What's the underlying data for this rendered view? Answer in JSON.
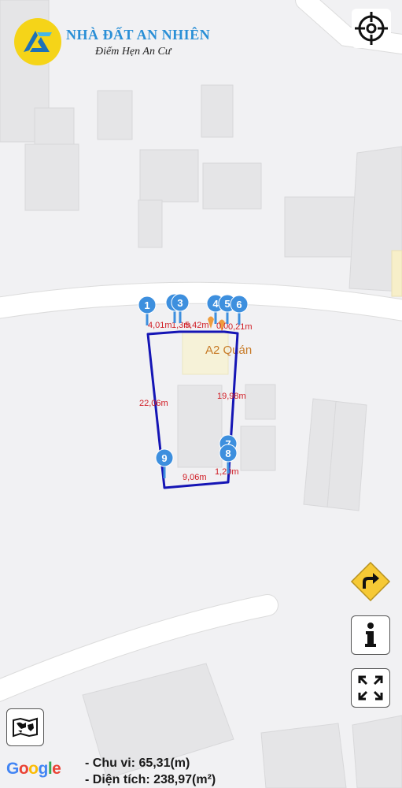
{
  "brand": {
    "name": "NHÀ ĐẤT AN NHIÊN",
    "slogan": "Điểm Hẹn An Cư",
    "accent": "#2a8fd6",
    "logo_color": "#f5d418"
  },
  "map": {
    "poi_label": "A2 Quán",
    "attribution": "Google",
    "boundary_color": "#1515b5",
    "label_color": "#d01c24",
    "pin_color": "#3d8fde",
    "markers": [
      "1",
      "2",
      "3",
      "4",
      "5",
      "6",
      "7",
      "8",
      "9"
    ],
    "dimensions": {
      "d1": "4,01m",
      "d2": "1,3m",
      "d3": "5,42m",
      "d4": "0,0",
      "d5": "0,21m",
      "d6": "22,06m",
      "d7": "19,98m",
      "d8": "9,06m",
      "d9": "1,20m"
    }
  },
  "controls": {
    "locate_icon": "crosshair-icon",
    "direction_icon": "turn-right-sign-icon",
    "info_icon": "info-icon",
    "expand_icon": "expand-icon",
    "layers_icon": "map-layers-icon"
  },
  "stats": {
    "perimeter": "- Chu vi: 65,31(m)",
    "area": "- Diện tích: 238,97(m²)"
  }
}
